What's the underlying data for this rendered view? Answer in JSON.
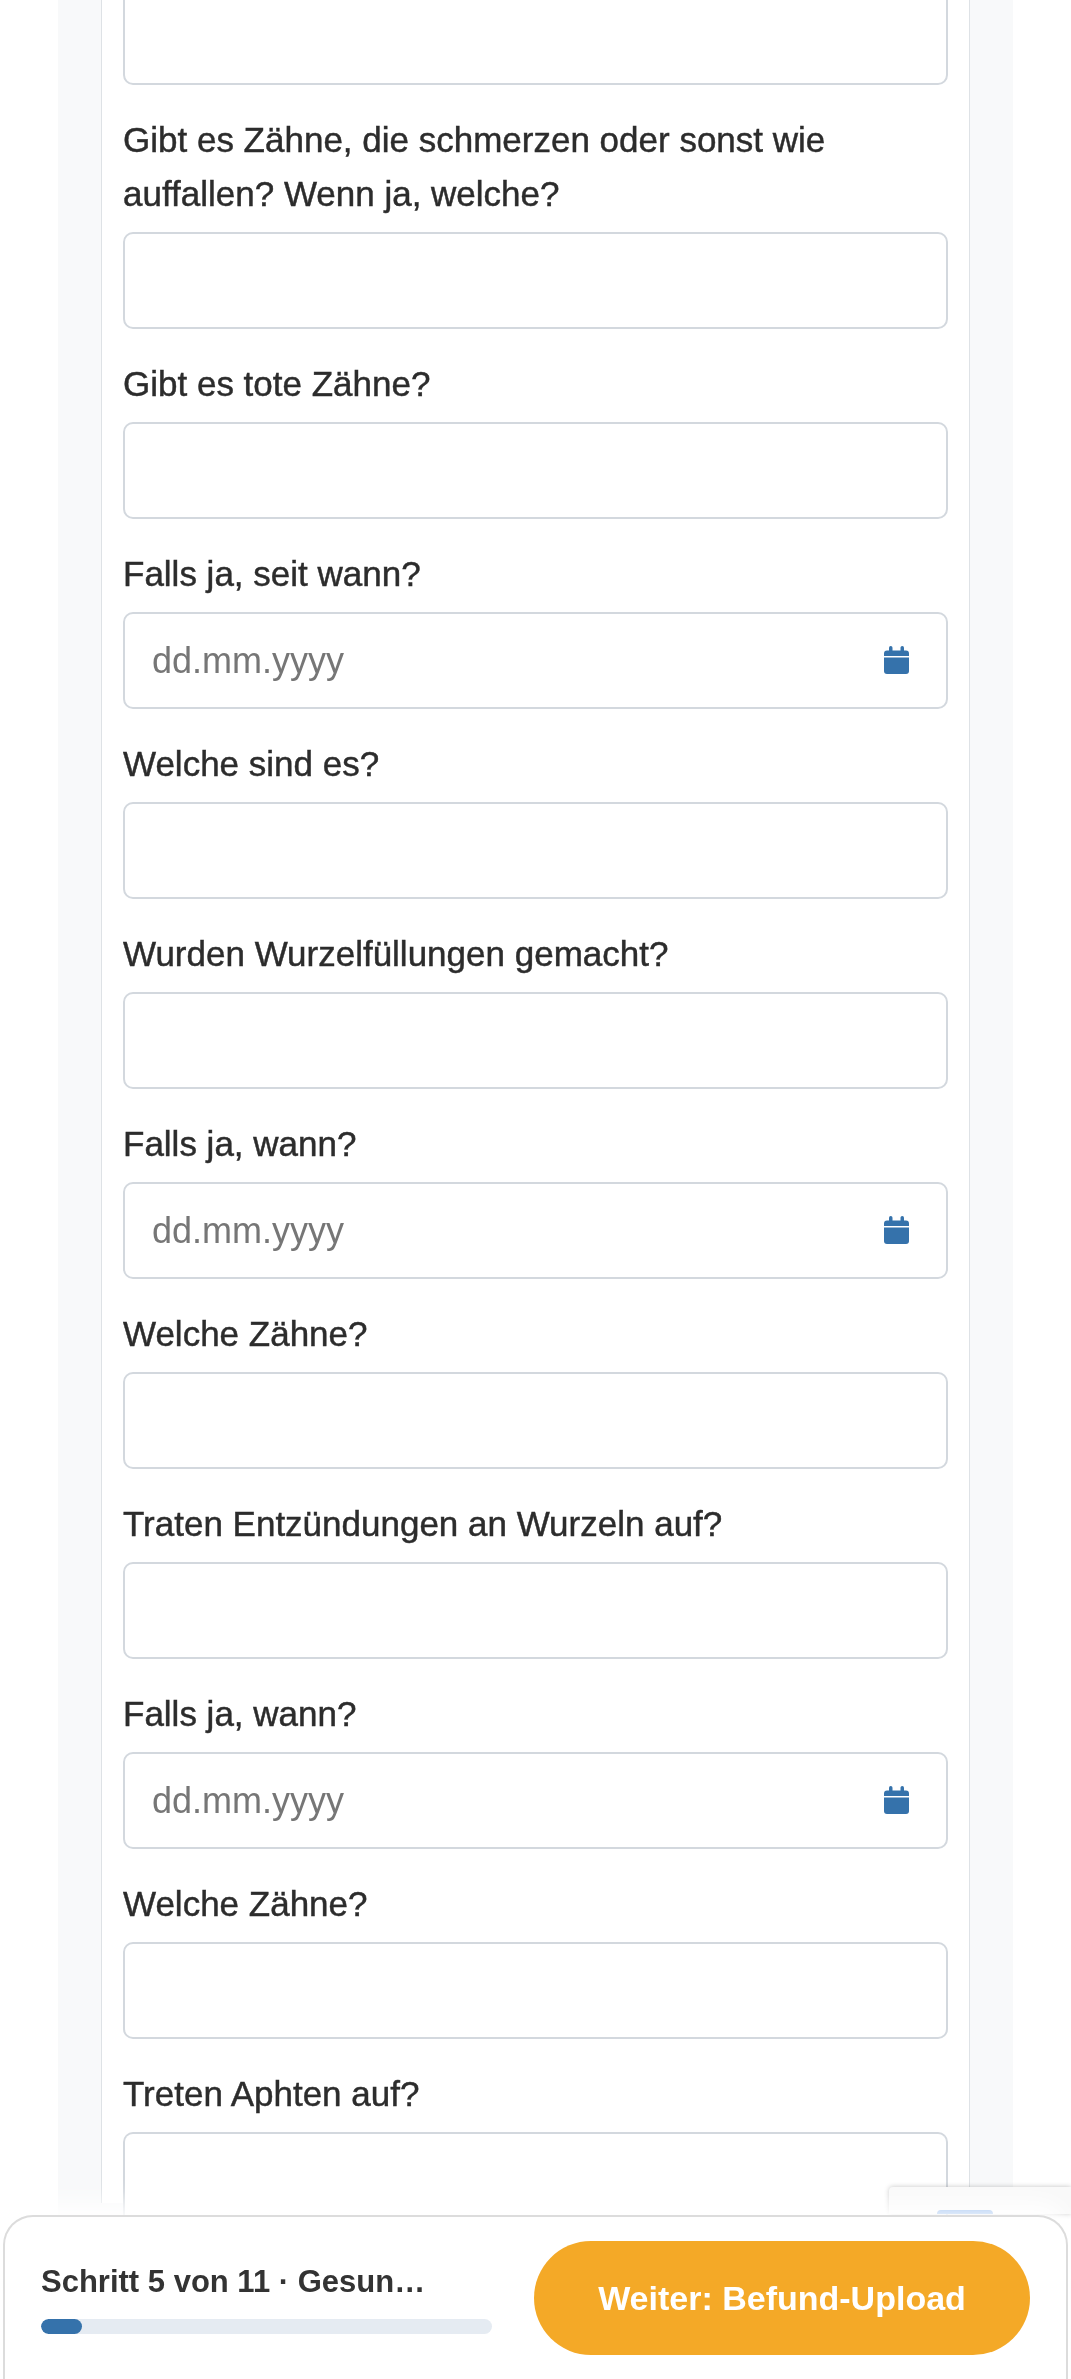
{
  "form": {
    "fields": [
      {
        "kind": "text"
      },
      {
        "kind": "text",
        "label": "Gibt es Zähne, die schmerzen oder sonst wie auffallen? Wenn ja, welche?"
      },
      {
        "kind": "text",
        "label": "Gibt es tote Zähne?"
      },
      {
        "kind": "date",
        "label": "Falls ja, seit wann?",
        "placeholder": "dd.mm.yyyy"
      },
      {
        "kind": "text",
        "label": "Welche sind es?"
      },
      {
        "kind": "text",
        "label": "Wurden Wurzelfüllungen gemacht?"
      },
      {
        "kind": "date",
        "label": "Falls ja, wann?",
        "placeholder": "dd.mm.yyyy"
      },
      {
        "kind": "text",
        "label": "Welche Zähne?"
      },
      {
        "kind": "text",
        "label": "Traten Entzündungen an Wurzeln auf?"
      },
      {
        "kind": "date",
        "label": "Falls ja, wann?",
        "placeholder": "dd.mm.yyyy"
      },
      {
        "kind": "text",
        "label": "Welche Zähne?"
      },
      {
        "kind": "text",
        "label": "Treten Aphten auf?"
      }
    ]
  },
  "footer": {
    "step_text": "Schritt 5 von 11 · Gesun…",
    "progress": {
      "level": 0.09
    },
    "next_button": "Weiter: Befund-Upload"
  }
}
